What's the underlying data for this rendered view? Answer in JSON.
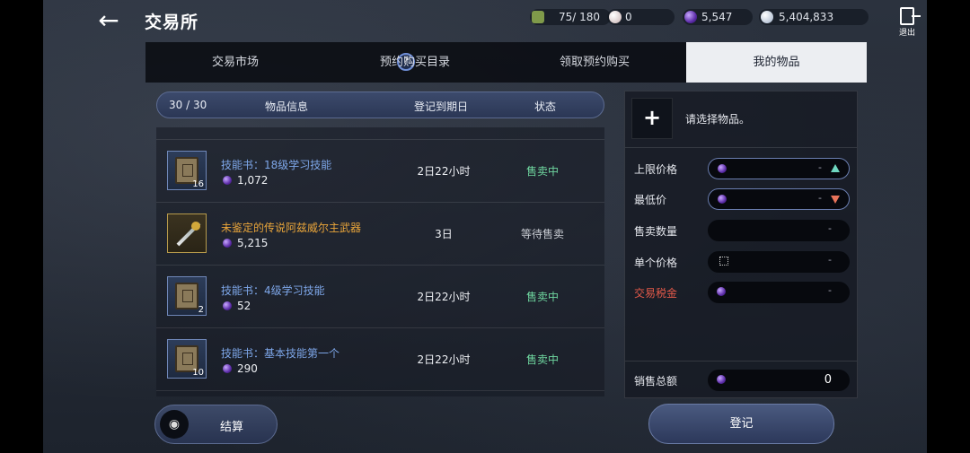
{
  "header": {
    "title": "交易所",
    "currencies": [
      {
        "icon": "bag-capacity-icon",
        "value": "75/ 180",
        "color": "#7f9a4a"
      },
      {
        "icon": "pearl-icon",
        "value": "0",
        "color": "#e8d6d6"
      },
      {
        "icon": "purple-gem-icon",
        "value": "5,547",
        "color": "#7a3fd0"
      },
      {
        "icon": "silver-coin-icon",
        "value": "5,404,833",
        "color": "#cfd8e8"
      }
    ],
    "exit_label": "退出"
  },
  "tabs": [
    {
      "label": "交易市场",
      "active": false
    },
    {
      "label": "预约购买目录",
      "active": false
    },
    {
      "label": "领取预约购买",
      "active": false
    },
    {
      "label": "我的物品",
      "active": true
    }
  ],
  "list": {
    "count": "30 / 30",
    "col_info": "物品信息",
    "col_date": "登记到期日",
    "col_status": "状态",
    "items": [
      {
        "name": "技能书：18级学习技能",
        "price": "1,072",
        "count": "16",
        "date": "2日22小时",
        "status": "售卖中",
        "icon": "skill-book-icon"
      },
      {
        "name": "未鉴定的传说阿兹威尔主武器",
        "price": "5,215",
        "count": "",
        "date": "3日",
        "status": "等待售卖",
        "icon": "sword-icon"
      },
      {
        "name": "技能书：4级学习技能",
        "price": "52",
        "count": "2",
        "date": "2日22小时",
        "status": "售卖中",
        "icon": "skill-book-icon"
      },
      {
        "name": "技能书：基本技能第一个",
        "price": "290",
        "count": "10",
        "date": "2日22小时",
        "status": "售卖中",
        "icon": "skill-book-icon"
      }
    ]
  },
  "panel": {
    "select_prompt": "请选择物品。",
    "upper_price_label": "上限价格",
    "min_price_label": "最低价",
    "sale_qty_label": "售卖数量",
    "unit_price_label": "单个价格",
    "tax_label": "交易税金",
    "total_label": "销售总额",
    "placeholder": "-",
    "total_value": "0"
  },
  "buttons": {
    "settle": "结算",
    "register": "登记"
  },
  "colors": {
    "accent_blue": "#7da6e8",
    "status_green": "#6fd7a0",
    "legend_gold": "#e9a53a",
    "tax_red": "#e65a4a"
  }
}
